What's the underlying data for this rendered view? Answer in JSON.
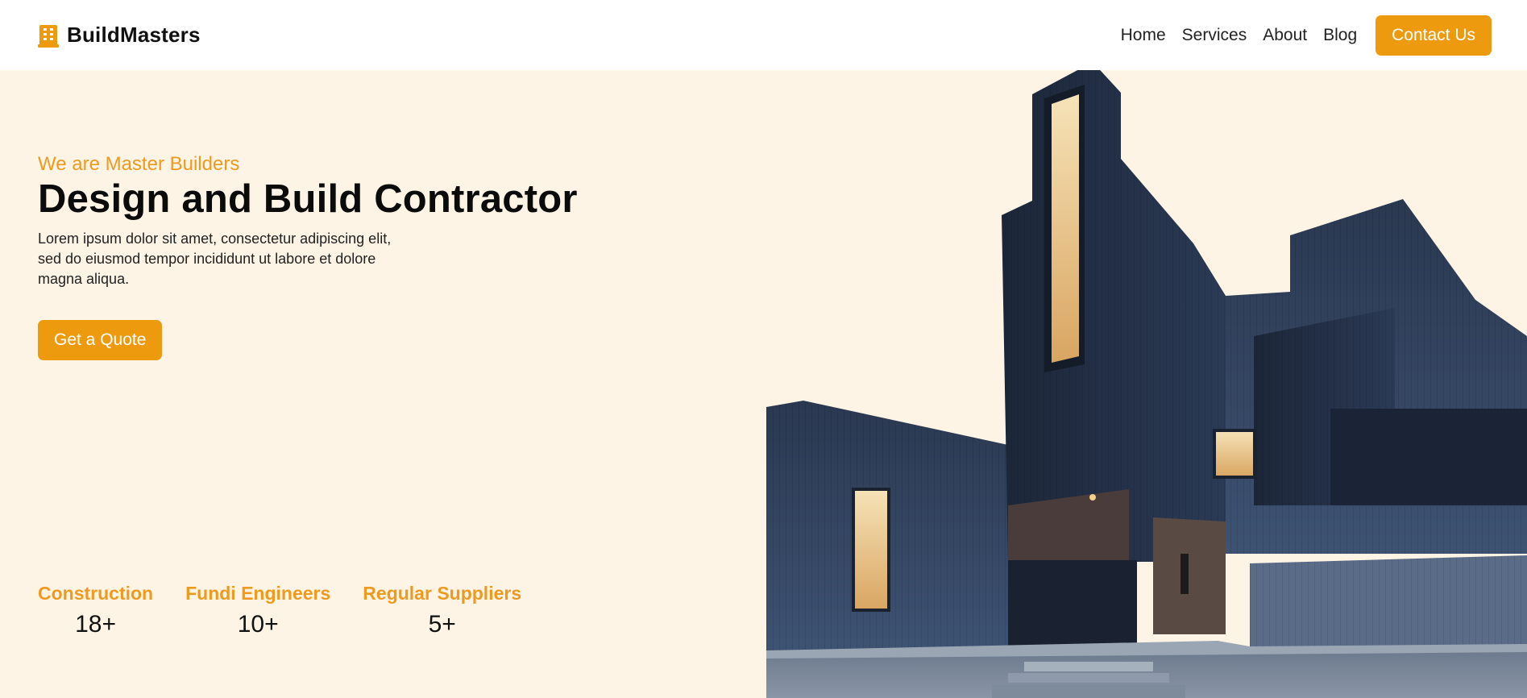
{
  "header": {
    "brand_name": "BuildMasters",
    "brand_icon": "building-icon",
    "nav": [
      "Home",
      "Services",
      "About",
      "Blog"
    ],
    "contact_label": "Contact Us"
  },
  "hero": {
    "eyebrow": "We are Master Builders",
    "headline": "Design and Build Contractor",
    "description": "Lorem ipsum dolor sit amet, consectetur adipiscing elit, sed do eiusmod tempor incididunt ut labore et dolore magna aliqua.",
    "cta_label": "Get a Quote"
  },
  "stats": [
    {
      "label": "Construction",
      "value": "18+"
    },
    {
      "label": "Fundi Engineers",
      "value": "10+"
    },
    {
      "label": "Regular Suppliers",
      "value": "5+"
    }
  ],
  "colors": {
    "accent": "#ee9a0e",
    "background": "#fdf4e6",
    "header": "#ffffff"
  }
}
